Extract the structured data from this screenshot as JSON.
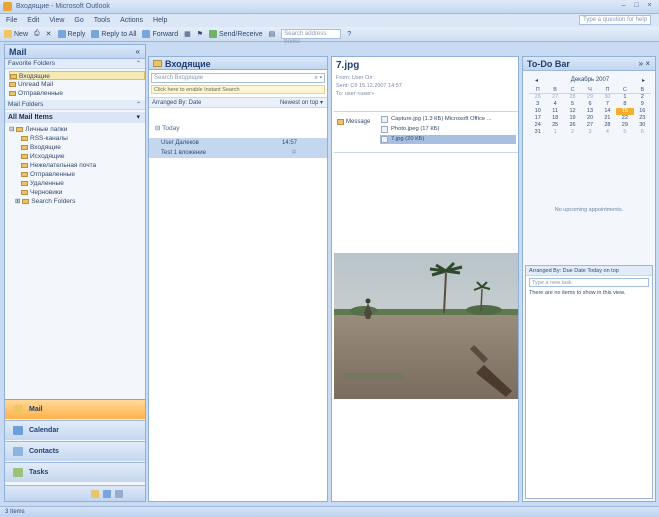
{
  "window": {
    "title": "Входящие - Microsoft Outlook",
    "controls": [
      "–",
      "□",
      "×"
    ]
  },
  "menu": [
    "File",
    "Edit",
    "View",
    "Go",
    "Tools",
    "Actions",
    "Help"
  ],
  "help_box": "Type a question for help",
  "toolbar": {
    "new": "New",
    "reply": "Reply",
    "reply_all": "Reply to All",
    "forward": "Forward",
    "send_receive": "Send/Receive",
    "search_placeholder": "Search address books"
  },
  "nav": {
    "title": "Mail",
    "favorites_label": "Favorite Folders",
    "favorites": [
      "Входящие",
      "Unread Mail",
      "Отправленные"
    ],
    "mail_folders_label": "Mail Folders",
    "all_mail_items": "All Mail Items",
    "tree": [
      "Личные папки",
      "RSS-каналы",
      "Входящие",
      "Исходящие",
      "Нежелательная почта",
      "Отправленные",
      "Удаленные",
      "Черновики",
      "Search Folders"
    ],
    "buttons": [
      "Mail",
      "Calendar",
      "Contacts",
      "Tasks"
    ]
  },
  "list": {
    "title": "Входящие",
    "search_placeholder": "Search Входящие",
    "search_hint": "Click here to enable Instant Search",
    "arrange_by": "Arranged By: Date",
    "sort": "Newest on top",
    "group": "Today",
    "messages": [
      {
        "from": "User Далеков",
        "time": "14:57"
      },
      {
        "from": "Test 1 вложение",
        "time": ""
      }
    ]
  },
  "reading": {
    "subject": "7.jpg",
    "from_label": "From:",
    "from_value": "User Ол",
    "sent_label": "Sent:",
    "sent_value": "Сб 15.12.2007 14:57",
    "to_label": "To:",
    "to_value": "user <user>",
    "message_btn": "Message",
    "attachments": [
      "Capture.jpg (1.3 КБ) Microsoft Office ...",
      "Photo.jpeg (17 КБ)",
      "7.jpg (20 КБ)"
    ]
  },
  "todo": {
    "title": "To-Do Bar",
    "month": "Декабрь 2007",
    "weekdays": [
      "П",
      "В",
      "С",
      "Ч",
      "П",
      "С",
      "В"
    ],
    "days": [
      "26",
      "27",
      "28",
      "29",
      "30",
      "1",
      "2",
      "3",
      "4",
      "5",
      "6",
      "7",
      "8",
      "9",
      "10",
      "11",
      "12",
      "13",
      "14",
      "15",
      "16",
      "17",
      "18",
      "19",
      "20",
      "21",
      "22",
      "23",
      "24",
      "25",
      "26",
      "27",
      "28",
      "29",
      "30",
      "31",
      "1",
      "2",
      "3",
      "4",
      "5",
      "6"
    ],
    "today_index": 19,
    "no_appointments": "No upcoming appointments.",
    "arrange": "Arranged By: Due Date",
    "sort": "Today on top",
    "new_task": "Type a new task",
    "no_tasks": "There are no items to show in this view."
  },
  "status": "3 Items",
  "colors": {
    "accent": "#ffb14a",
    "pane_border": "#8fb0da",
    "header": "#1f3f73"
  }
}
